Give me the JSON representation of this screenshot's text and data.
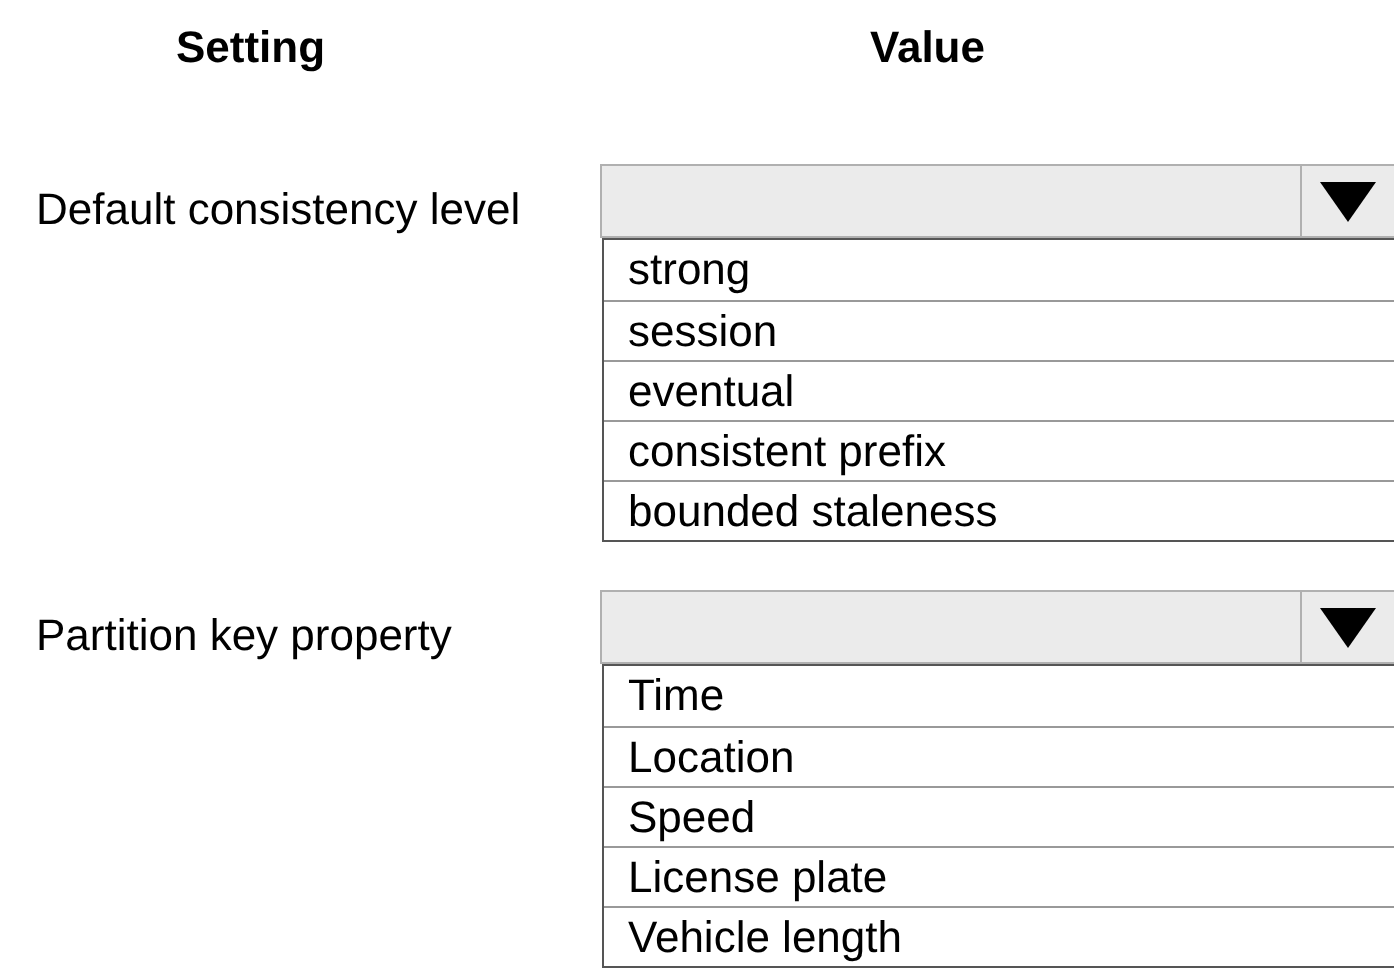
{
  "headers": [
    "Setting",
    "Value"
  ],
  "rows": [
    {
      "label": "Default consistency level",
      "options": [
        "strong",
        "session",
        "eventual",
        "consistent prefix",
        "bounded staleness"
      ]
    },
    {
      "label": "Partition key property",
      "options": [
        "Time",
        "Location",
        "Speed",
        "License plate",
        "Vehicle length"
      ]
    }
  ]
}
